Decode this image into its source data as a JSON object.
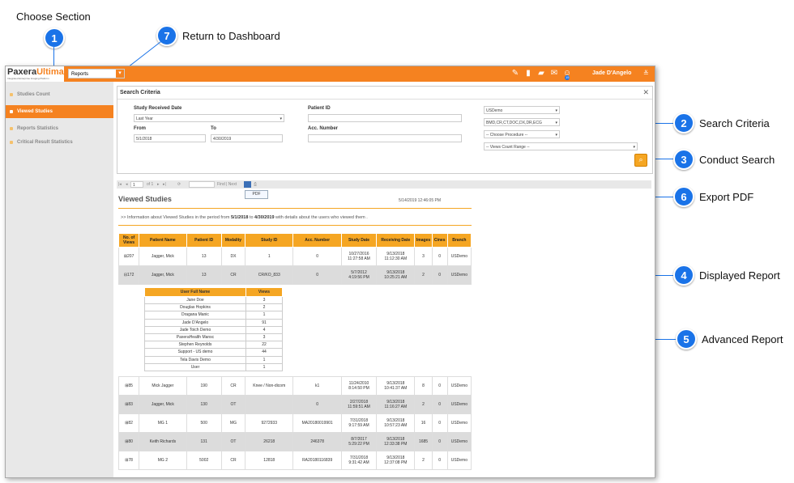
{
  "callouts": {
    "c1": {
      "num": "1",
      "label": "Choose Section"
    },
    "c7": {
      "num": "7",
      "label": "Return to Dashboard"
    },
    "c2": {
      "num": "2",
      "label": "Search Criteria"
    },
    "c3": {
      "num": "3",
      "label": "Conduct Search"
    },
    "c6": {
      "num": "6",
      "label": "Export PDF"
    },
    "c4": {
      "num": "4",
      "label": "Displayed Report"
    },
    "c5": {
      "num": "5",
      "label": "Advanced Report"
    }
  },
  "app": {
    "logo_main": "Paxera",
    "logo_accent": "Ultima",
    "logo_sub": "Integrated Enterprise Imaging Platform",
    "section_select": "Reports",
    "user_name": "Jade D'Angelo",
    "badge_count": "15",
    "colors": {
      "brand": "#f58220",
      "accent": "#1a73e8"
    }
  },
  "sidebar": {
    "items": [
      {
        "label": "Studies Count"
      },
      {
        "label": "Viewed Studies"
      },
      {
        "label": "Reports Statistics"
      },
      {
        "label": "Critical Result Statistics"
      }
    ]
  },
  "search": {
    "title": "Search Criteria",
    "close": "✕",
    "study_received_label": "Study Received Date",
    "study_received_value": "Last Year",
    "from_label": "From",
    "from_value": "5/1/2018",
    "to_label": "To",
    "to_value": "4/30/2019",
    "patient_id_label": "Patient ID",
    "acc_number_label": "Acc. Number",
    "branch_value": "USDemo",
    "modality_value": "BMD,CR,CT,DOC,DX,DR,ECG",
    "procedure_value": "-- Choose Procedure --",
    "views_count_value": "-- Views Count Range --"
  },
  "pager": {
    "page_input": "1",
    "of_pages": "of 1",
    "find_next": "Find | Next",
    "pdf_option": "PDF"
  },
  "report": {
    "title": "Viewed Studies",
    "date": "5/14/2019 12:46:05 PM",
    "info_prefix": ">>  Information about Viewed Studies in the period from",
    "info_from": "5/1/2018",
    "info_to_word": "to",
    "info_to": "4/30/2019",
    "info_suffix": "with details about the users who viewed them  .",
    "headers": [
      "No. of Views",
      "Patient Name",
      "Patient ID",
      "Modality",
      "Study ID",
      "Acc. Number",
      "Study Date",
      "Receiving Date",
      "Images",
      "Cines",
      "Branch"
    ],
    "rows": [
      {
        "views": "⊞207",
        "name": "Jagger, Mick",
        "pid": "13",
        "mod": "DX",
        "sid": "1",
        "acc": "0",
        "sdate": "10/27/2016\n11:27:58 AM",
        "rdate": "9/13/2018\n11:12:30 AM",
        "images": "3",
        "cines": "0",
        "branch": "USDemo",
        "gray": false
      },
      {
        "views": "⊟172",
        "name": "Jagger, Mick",
        "pid": "13",
        "mod": "CR",
        "sid": "CR/KO_833",
        "acc": "0",
        "sdate": "5/7/2012\n4:19:56 PM",
        "rdate": "9/13/2018\n10:25:21 AM",
        "images": "2",
        "cines": "0",
        "branch": "USDemo",
        "gray": true
      },
      {
        "views": "⊞85",
        "name": "Mick Jagger",
        "pid": "190",
        "mod": "CR",
        "sid": "Knee / Non-dicom",
        "acc": "k1",
        "sdate": "11/24/2010\n8:14:50 PM",
        "rdate": "9/13/2018\n10:41:37 AM",
        "images": "8",
        "cines": "0",
        "branch": "USDemo",
        "gray": false
      },
      {
        "views": "⊞83",
        "name": "Jagger, Mick",
        "pid": "130",
        "mod": "OT",
        "sid": "",
        "acc": "0",
        "sdate": "2/27/2018\n11:59:51 AM",
        "rdate": "9/13/2018\n11:16:27 AM",
        "images": "2",
        "cines": "0",
        "branch": "USDemo",
        "gray": true
      },
      {
        "views": "⊞82",
        "name": "MG 1",
        "pid": "500",
        "mod": "MG",
        "sid": "9272933",
        "acc": "MA20180019901",
        "sdate": "7/31/2018\n9:17:59 AM",
        "rdate": "9/13/2018\n10:57:23 AM",
        "images": "16",
        "cines": "0",
        "branch": "USDemo",
        "gray": false
      },
      {
        "views": "⊞80",
        "name": "Keith Richards",
        "pid": "131",
        "mod": "OT",
        "sid": "26218",
        "acc": "246378",
        "sdate": "8/7/2017\n5:29:22 PM",
        "rdate": "9/13/2018\n12:33:38 PM",
        "images": "1685",
        "cines": "0",
        "branch": "USDemo",
        "gray": true
      },
      {
        "views": "⊞78",
        "name": "MG 2",
        "pid": "5002",
        "mod": "CR",
        "sid": "12818",
        "acc": "RA20180116839",
        "sdate": "7/31/2018\n9:31:42 AM",
        "rdate": "9/13/2018\n12:37:08 PM",
        "images": "2",
        "cines": "0",
        "branch": "USDemo",
        "gray": false
      }
    ],
    "sub_headers": [
      "User Full Name",
      "Views"
    ],
    "sub_rows": [
      [
        "Jane Doe",
        "3"
      ],
      [
        "Douglas Hopkins",
        "2"
      ],
      [
        "Dragana Manic",
        "1"
      ],
      [
        "Jade D'Angelo",
        "91"
      ],
      [
        "Jade Toich Demo",
        "4"
      ],
      [
        "PaxeraHealth Mansc",
        "3"
      ],
      [
        "Stephen Reynolds",
        "22"
      ],
      [
        "Support - US demo",
        "44"
      ],
      [
        "Tela Davis Demo",
        "1"
      ],
      [
        "User",
        "1"
      ]
    ]
  }
}
